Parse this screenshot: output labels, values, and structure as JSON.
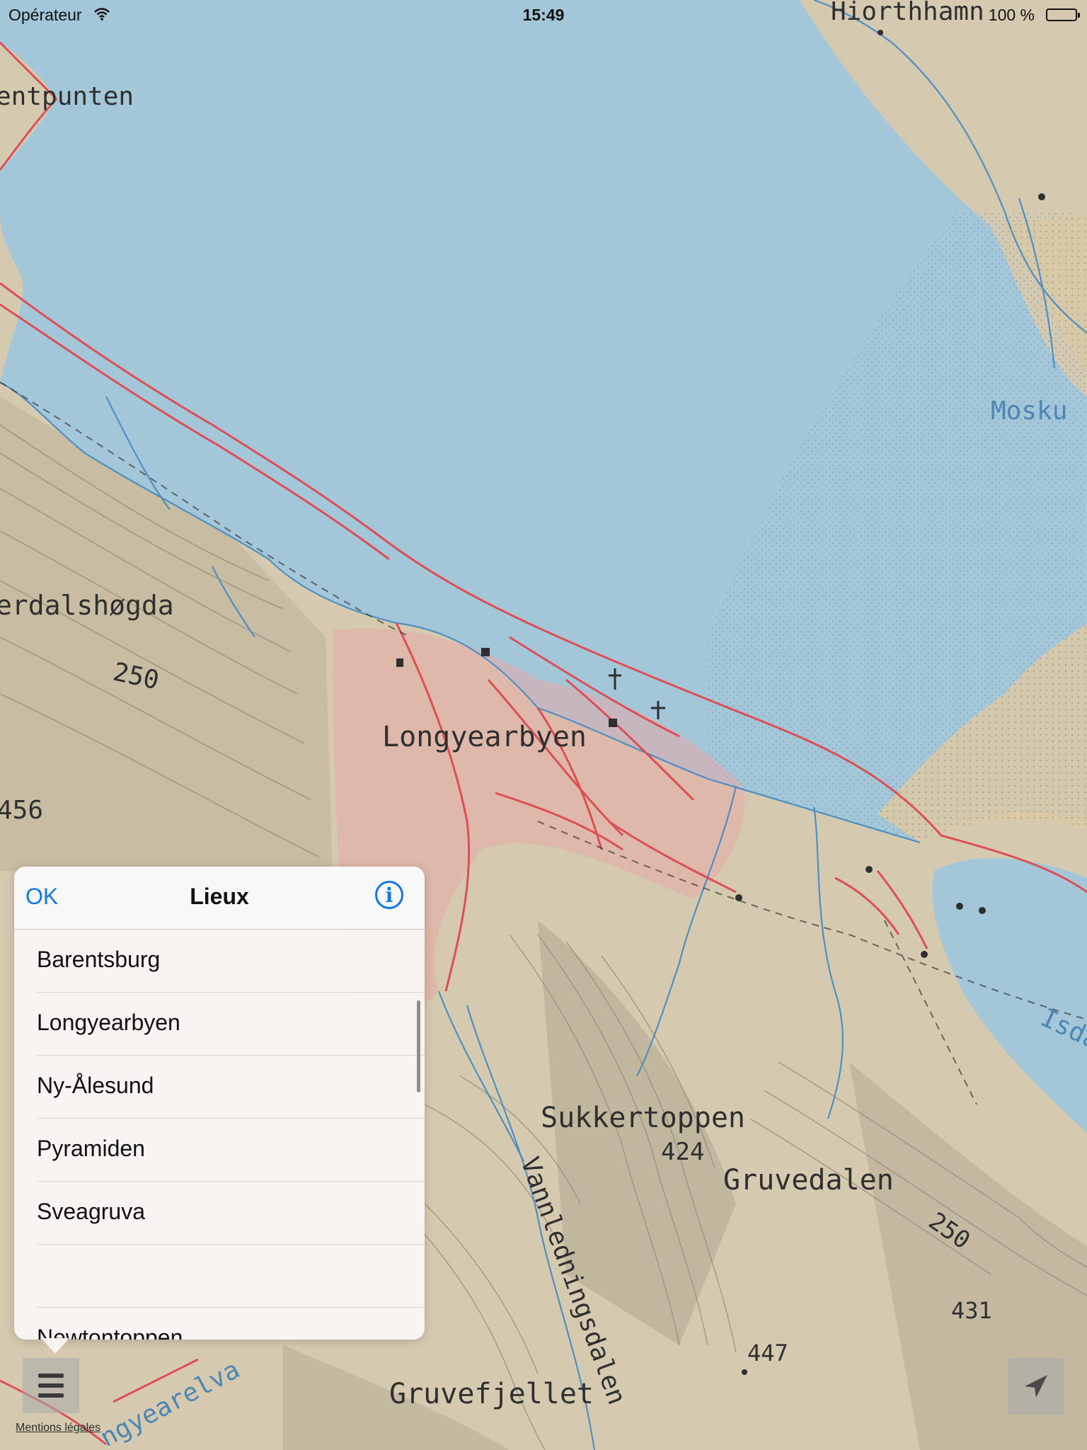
{
  "status_bar": {
    "carrier": "Opérateur",
    "time": "15:49",
    "battery": "100 %"
  },
  "map": {
    "labels": {
      "hiorthhamn": "Hiorthhamn",
      "sentpunten": "entpunten",
      "moskus": "Mosku",
      "verdalshogda": "erdalshøgda",
      "c250_left": "250",
      "c456": "456",
      "longyearbyen": "Longyearbyen",
      "sukkertoppen": "Sukkertoppen",
      "s424": "424",
      "gruvedalen": "Gruvedalen",
      "c250_right": "250",
      "vannledningsdalen": "Vannledningsdalen",
      "s431": "431",
      "s447": "447",
      "gruvefjellet": "Gruvefjellet",
      "isdammen": "Isda",
      "longyearelva": "ngyearelva"
    }
  },
  "places_popover": {
    "ok_label": "OK",
    "title": "Lieux",
    "info_glyph": "i",
    "items": [
      "Barentsburg",
      "Longyearbyen",
      "Ny-Ålesund",
      "Pyramiden",
      "Sveagruva",
      "",
      "Newtontoppen"
    ]
  },
  "controls": {
    "menu_icon": "hamburger-icon",
    "legal_label": "Mentions légales",
    "locate_icon": "location-arrow-icon"
  },
  "colors": {
    "sea": "#a3c6d9",
    "land": "#d6ccb3",
    "roads": "#e0545a",
    "accent": "#1477e6"
  }
}
